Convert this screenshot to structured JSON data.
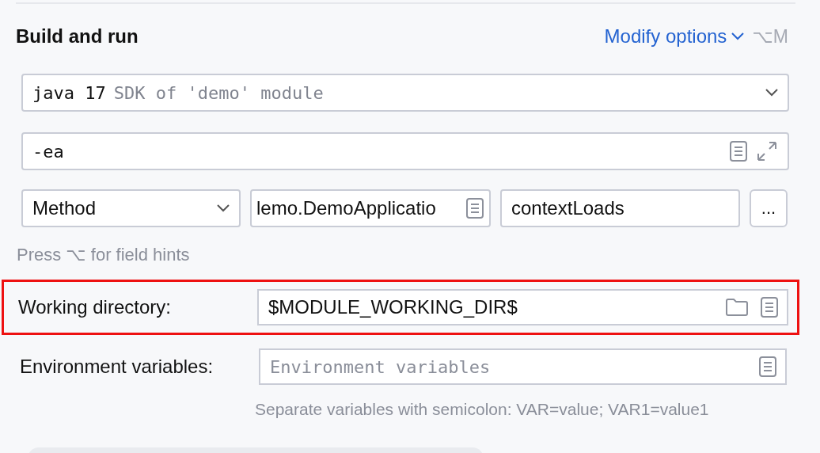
{
  "section": {
    "title": "Build and run",
    "modify_options": "Modify options",
    "shortcut": "⌥M"
  },
  "sdk": {
    "name": "java 17",
    "description": "SDK of 'demo' module"
  },
  "vm_options": {
    "value": "-ea"
  },
  "test_target": {
    "kind_value": "Method",
    "class_value": "lemo.DemoApplicatio",
    "method_value": "contextLoads",
    "more": "..."
  },
  "hint": "Press ⌥ for field hints",
  "rows": [
    {
      "label": "Working directory:",
      "value": "$MODULE_WORKING_DIR$",
      "kind": "directory",
      "highlighted": true
    },
    {
      "label": "Environment variables:",
      "placeholder": "Environment variables",
      "kind": "env",
      "highlighted": false
    }
  ],
  "env_help": "Separate variables with semicolon: VAR=value; VAR1=value1"
}
